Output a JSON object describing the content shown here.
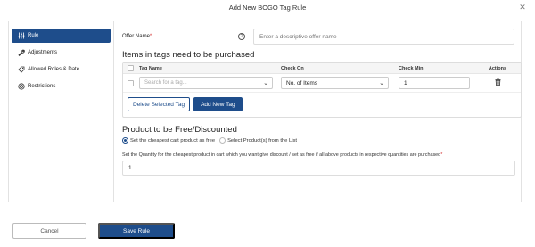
{
  "modal": {
    "title": "Add New BOGO Tag Rule",
    "close_icon": "close-icon"
  },
  "sidebar": {
    "items": [
      {
        "label": "Rule",
        "icon": "sliders-icon",
        "active": true
      },
      {
        "label": "Adjustments",
        "icon": "wrench-icon",
        "active": false
      },
      {
        "label": "Allowed Roles & Date",
        "icon": "tag-icon",
        "active": false
      },
      {
        "label": "Restrictions",
        "icon": "restrictions-icon",
        "active": false
      }
    ]
  },
  "offer": {
    "label": "Offer Name",
    "required_mark": "*",
    "placeholder": "Enter a descriptive offer name"
  },
  "tags_section": {
    "title": "Items in tags need to be purchased",
    "columns": [
      "Tag Name",
      "Check On",
      "Check Min",
      "Actions"
    ],
    "rows": [
      {
        "tag_placeholder": "Search for a tag...",
        "check_on": "No. of Items",
        "check_min": "1",
        "action_icon": "trash-icon"
      }
    ],
    "delete_label": "Delete Selected Tag",
    "add_label": "Add New Tag"
  },
  "discount_section": {
    "title": "Product to be Free/Discounted",
    "options": [
      {
        "label": "Set the cheapest cart product as free",
        "selected": true
      },
      {
        "label": "Select Product(s) from the List",
        "selected": false
      }
    ],
    "quantity_label": "Set the Quantity for the cheapest product in cart which you want give discount / set as free if all above products in respective quantities are purchased",
    "quantity_required_mark": "*",
    "quantity_value": "1"
  },
  "footer": {
    "cancel_label": "Cancel",
    "save_label": "Save Rule"
  },
  "colors": {
    "primary": "#1e4d8b",
    "required": "#d32f2f"
  }
}
